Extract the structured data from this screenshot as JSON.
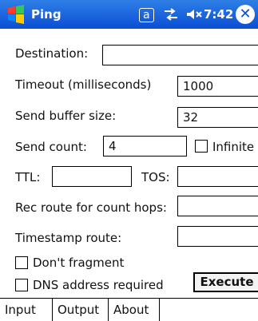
{
  "titlebar": {
    "title": "Ping",
    "start_icon": "windows-flag-icon",
    "status_a": "a",
    "network_icon": "network-icon",
    "volume_icon": "volume-muted-icon",
    "time": "7:42",
    "close_icon": "close-icon"
  },
  "form": {
    "destination": {
      "label": "Destination:",
      "value": ""
    },
    "timeout": {
      "label": "Timeout (milliseconds)",
      "value": "1000"
    },
    "buffer": {
      "label": "Send buffer size:",
      "value": "32"
    },
    "send_count": {
      "label": "Send count:",
      "value": "4"
    },
    "infinite": {
      "label": "Infinite",
      "checked": false
    },
    "ttl": {
      "label": "TTL:",
      "value": ""
    },
    "tos": {
      "label": "TOS:",
      "value": ""
    },
    "rec_route": {
      "label": "Rec route for count hops:",
      "value": ""
    },
    "timestamp": {
      "label": "Timestamp route:",
      "value": ""
    },
    "dont_fragment": {
      "label": "Don't fragment",
      "checked": false
    },
    "dns_required": {
      "label": "DNS address required",
      "checked": false
    },
    "execute_label": "Execute"
  },
  "tabs": [
    {
      "label": "Input",
      "active": true
    },
    {
      "label": "Output",
      "active": false
    },
    {
      "label": "About",
      "active": false
    }
  ],
  "colors": {
    "titlebar": "#0b4ed6",
    "accent": "#2f7fe6"
  }
}
